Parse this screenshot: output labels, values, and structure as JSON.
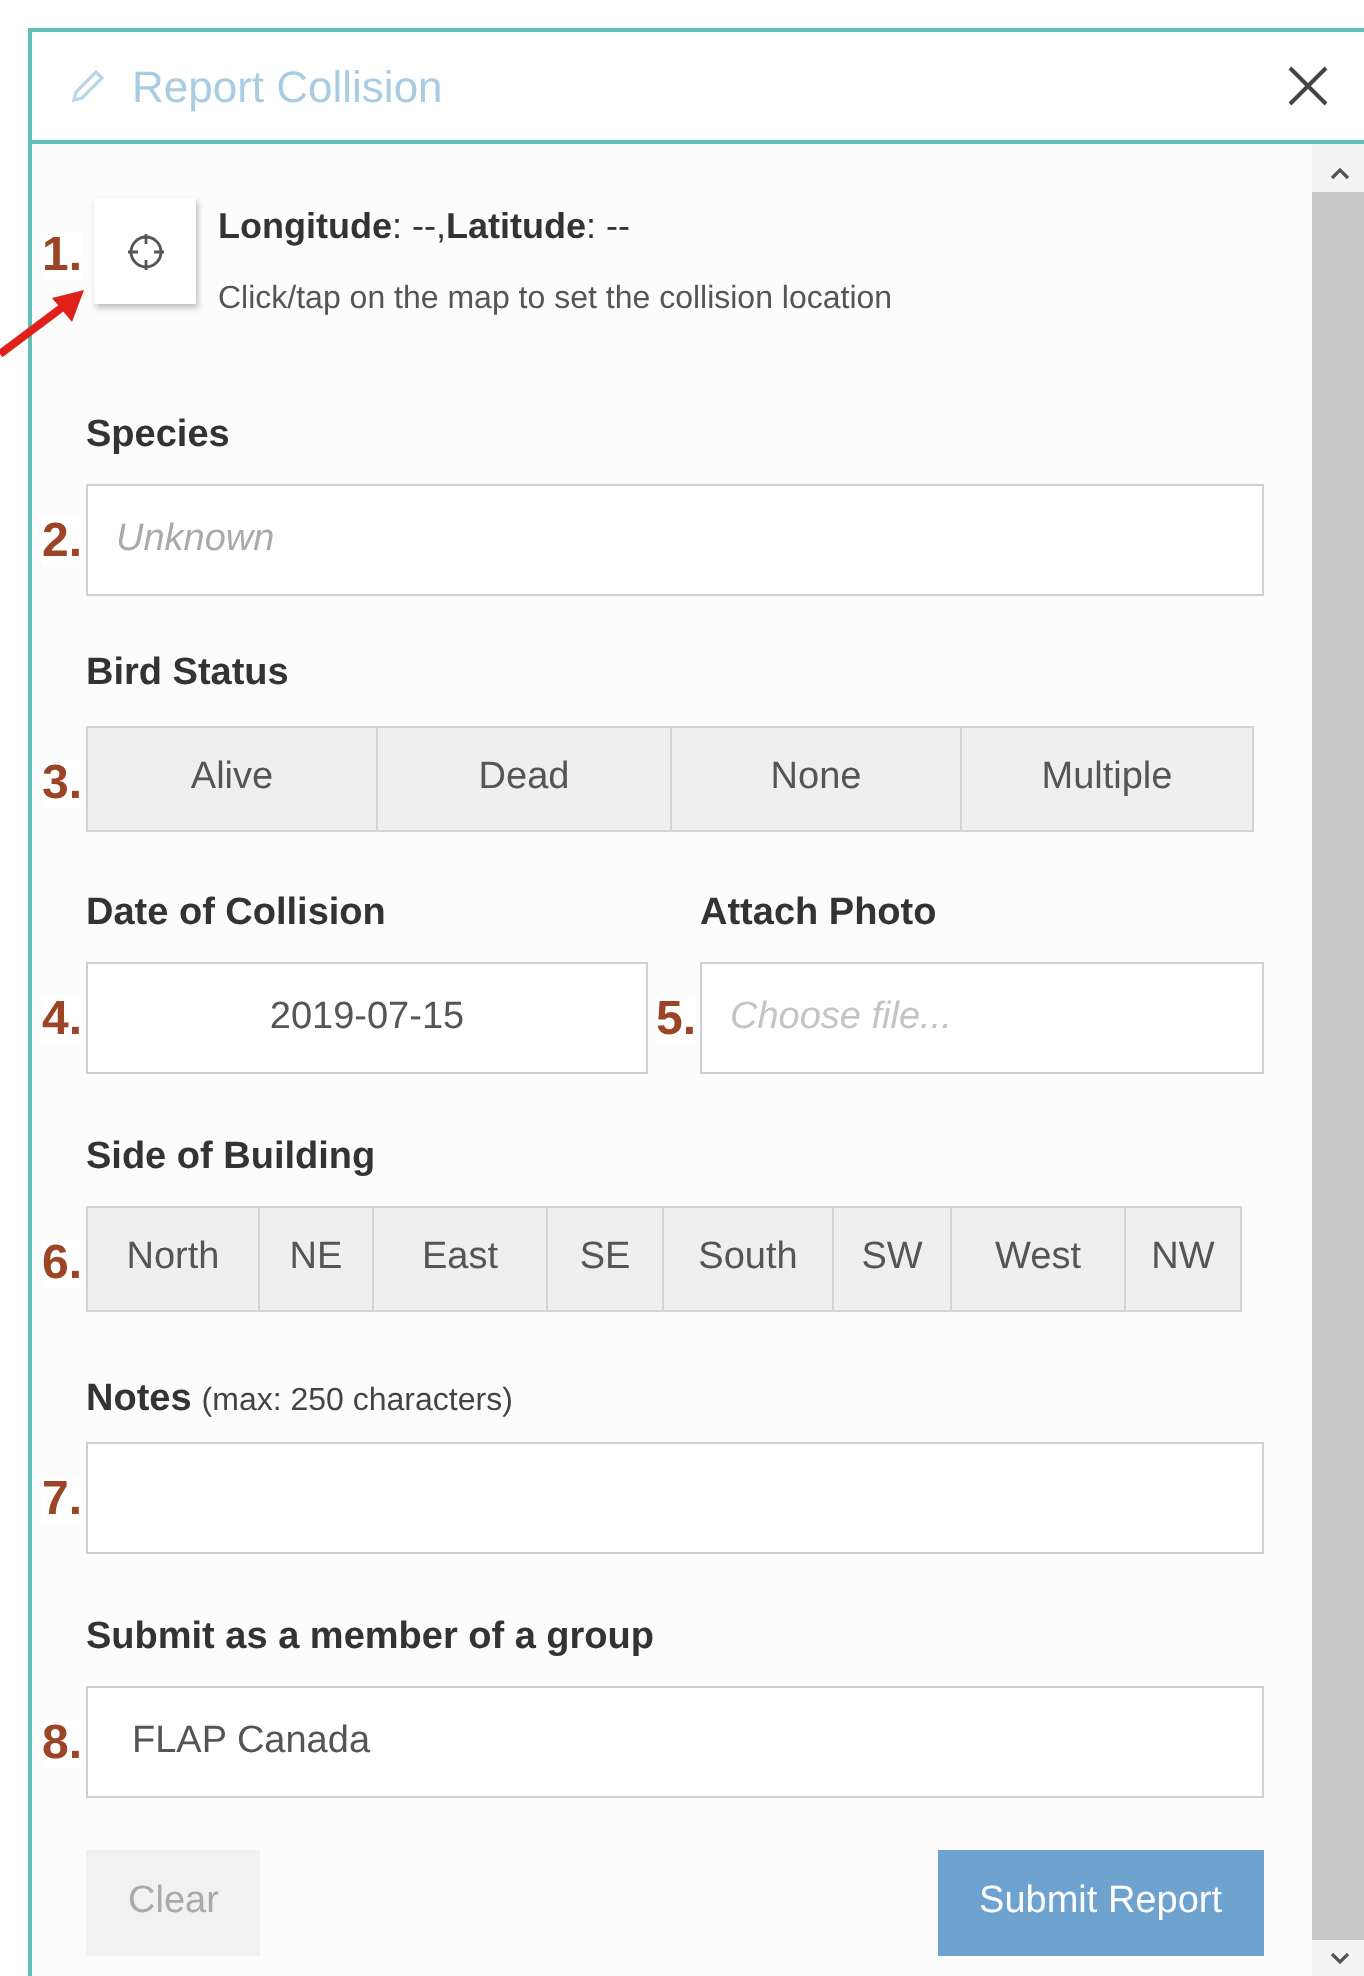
{
  "window": {
    "title": "Report Collision"
  },
  "location": {
    "heading": "**Longitude**: --,**Latitude**: --",
    "hint": "Click/tap on the map to set the collision location"
  },
  "species": {
    "label": "Species",
    "placeholder": "Unknown"
  },
  "bird_status": {
    "label": "Bird Status",
    "options": [
      {
        "label": "Alive",
        "selected": false
      },
      {
        "label": "Dead",
        "selected": false
      },
      {
        "label": "None",
        "selected": false
      },
      {
        "label": "Multiple",
        "selected": false
      }
    ]
  },
  "date": {
    "label": "Date of Collision",
    "value": "2019-07-15"
  },
  "photo": {
    "label": "Attach Photo",
    "placeholder": "Choose file..."
  },
  "side_of_building": {
    "label": "Side of Building",
    "options": [
      {
        "label": "North",
        "selected": false
      },
      {
        "label": "NE",
        "selected": false
      },
      {
        "label": "East",
        "selected": false
      },
      {
        "label": "SE",
        "selected": false
      },
      {
        "label": "South",
        "selected": false
      },
      {
        "label": "SW",
        "selected": false
      },
      {
        "label": "West",
        "selected": false
      },
      {
        "label": "NW",
        "selected": false
      }
    ]
  },
  "notes": {
    "label": "Notes",
    "hint": "(max: 250 characters)"
  },
  "group": {
    "label": "Submit as a member of a group",
    "value": "FLAP Canada"
  },
  "buttons": [
    {
      "label": "Clear",
      "kind": "secondary",
      "disabled": true
    },
    {
      "label": "Submit Report",
      "kind": "primary",
      "disabled": true
    }
  ],
  "annotations": [
    "1.",
    "2.",
    "3.",
    "4.",
    "5.",
    "6.",
    "7.",
    "8."
  ]
}
